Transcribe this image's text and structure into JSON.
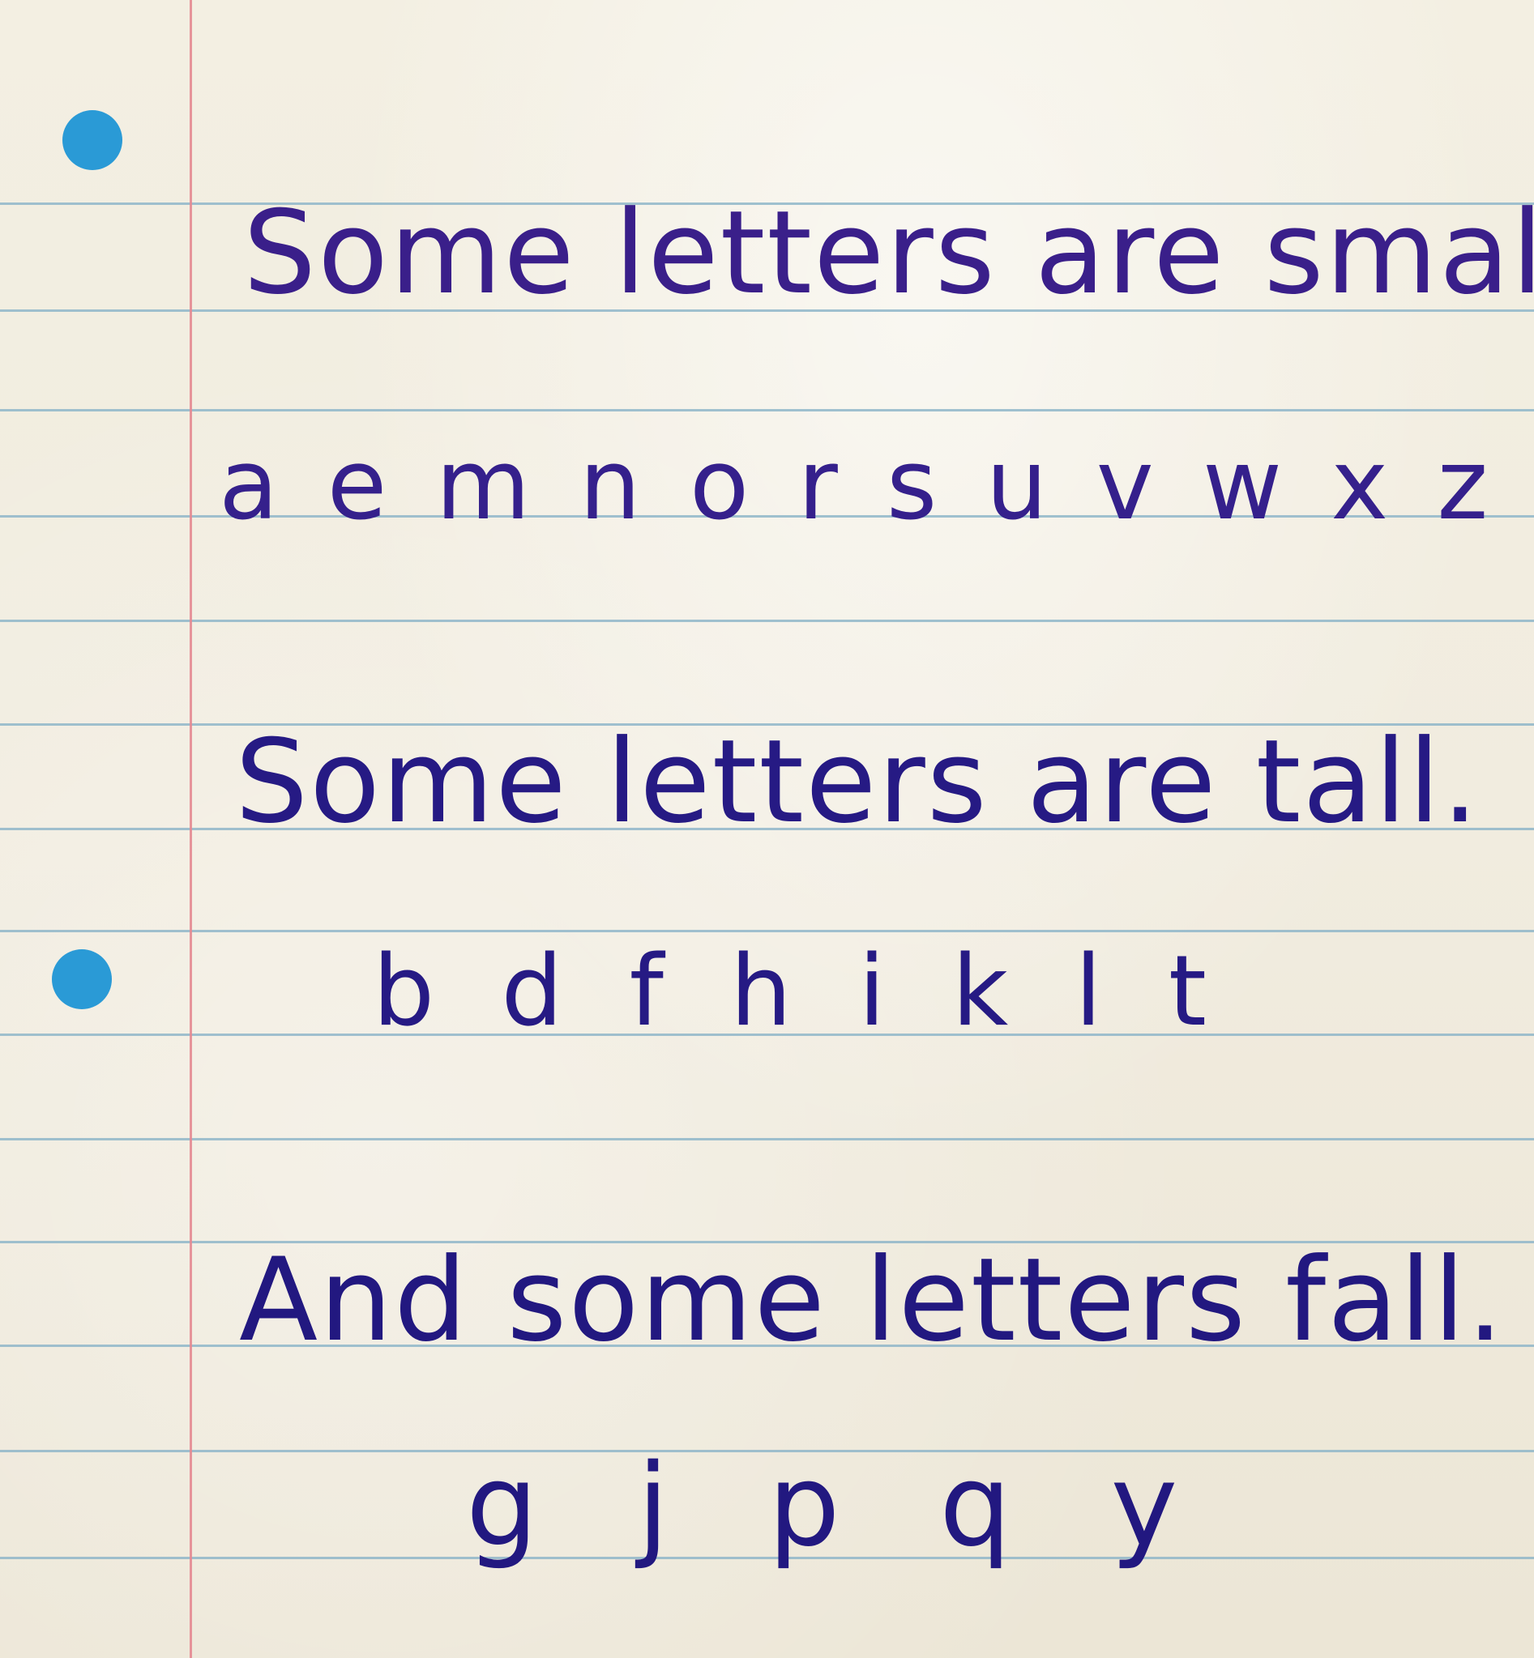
{
  "paper": {
    "background": "#f1ecdf",
    "rule_color": "#8fb6c9",
    "margin_color": "#e48a92",
    "hole_color": "#2a9ad6",
    "ink_color": "#2e1c86"
  },
  "chart": {
    "lines": [
      {
        "text": "Some letters are small."
      },
      {
        "text": "a e m n o r s u v w x z"
      },
      {
        "text": "Some letters are tall."
      },
      {
        "text": "b d f h i k l t"
      },
      {
        "text": "And some letters fall."
      },
      {
        "text": "g j p q y"
      }
    ]
  }
}
